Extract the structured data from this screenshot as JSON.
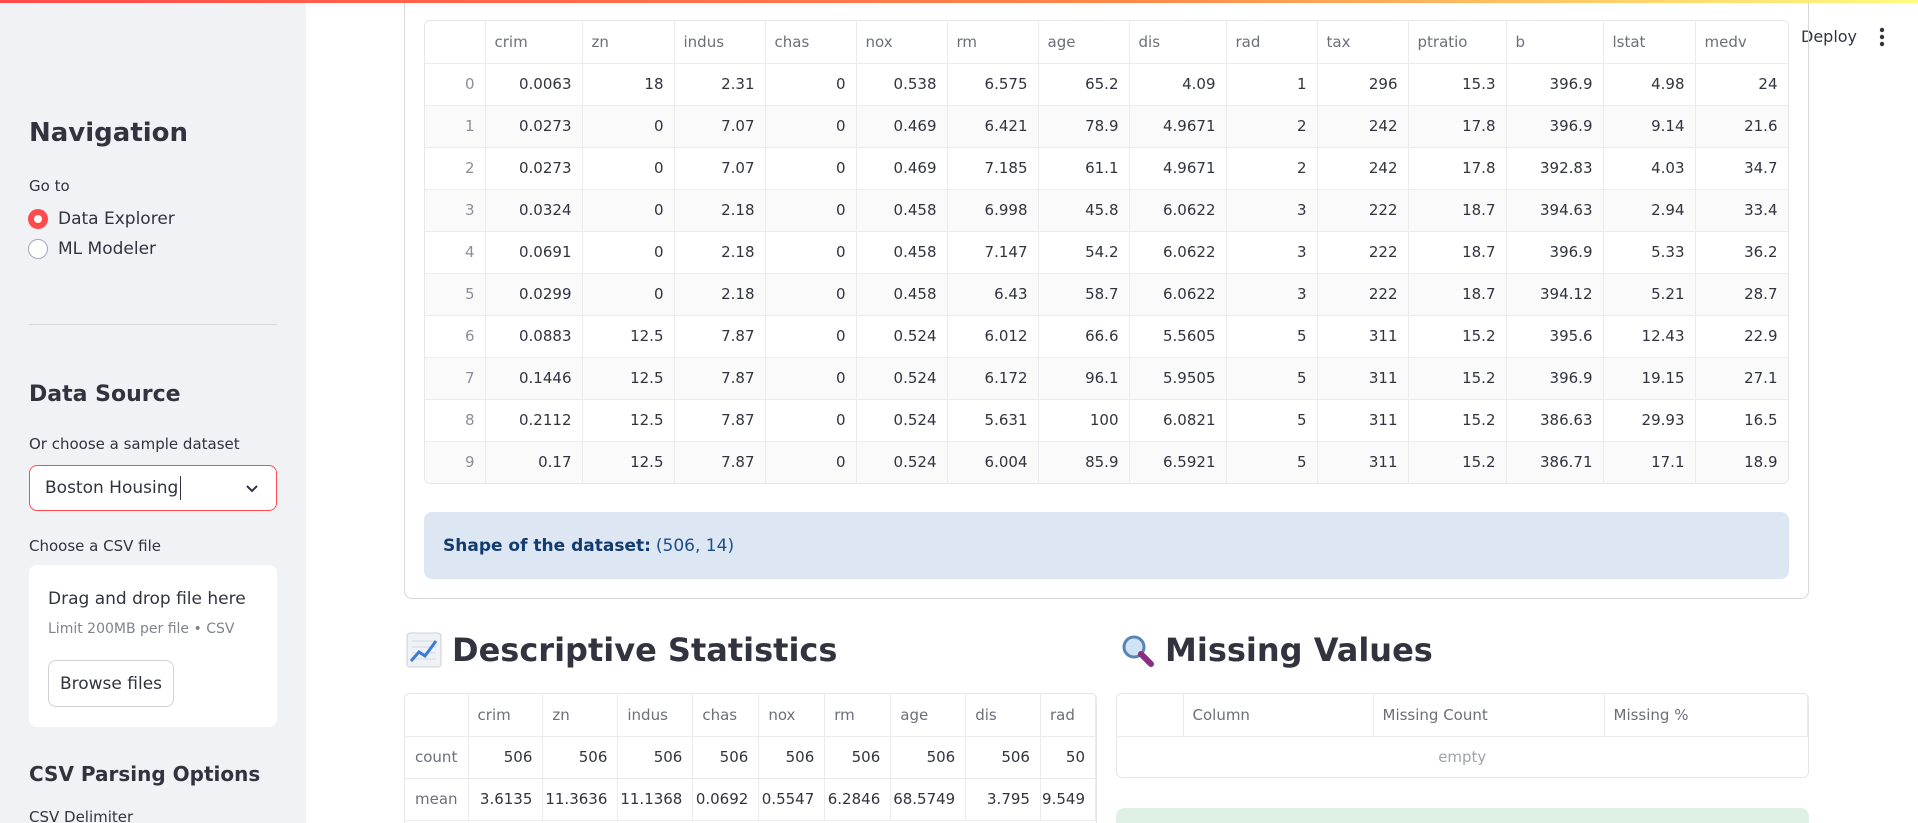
{
  "sidebar": {
    "nav_title": "Navigation",
    "goto_label": "Go to",
    "options": [
      {
        "label": "Data Explorer",
        "selected": true
      },
      {
        "label": "ML Modeler",
        "selected": false
      }
    ],
    "data_source_title": "Data Source",
    "sample_label": "Or choose a sample dataset",
    "sample_value": "Boston Housing",
    "csv_label": "Choose a CSV file",
    "dropzone_title": "Drag and drop file here",
    "dropzone_sub": "Limit 200MB per file • CSV",
    "browse_label": "Browse files",
    "csv_options_title": "CSV Parsing Options",
    "delimiter_label": "CSV Delimiter"
  },
  "header": {
    "deploy_label": "Deploy",
    "menu_icon": "kebab-menu-icon"
  },
  "dataframe": {
    "columns": [
      "",
      "crim",
      "zn",
      "indus",
      "chas",
      "nox",
      "rm",
      "age",
      "dis",
      "rad",
      "tax",
      "ptratio",
      "b",
      "lstat",
      "medv"
    ],
    "rows": [
      [
        "0",
        "0.0063",
        "18",
        "2.31",
        "0",
        "0.538",
        "6.575",
        "65.2",
        "4.09",
        "1",
        "296",
        "15.3",
        "396.9",
        "4.98",
        "24"
      ],
      [
        "1",
        "0.0273",
        "0",
        "7.07",
        "0",
        "0.469",
        "6.421",
        "78.9",
        "4.9671",
        "2",
        "242",
        "17.8",
        "396.9",
        "9.14",
        "21.6"
      ],
      [
        "2",
        "0.0273",
        "0",
        "7.07",
        "0",
        "0.469",
        "7.185",
        "61.1",
        "4.9671",
        "2",
        "242",
        "17.8",
        "392.83",
        "4.03",
        "34.7"
      ],
      [
        "3",
        "0.0324",
        "0",
        "2.18",
        "0",
        "0.458",
        "6.998",
        "45.8",
        "6.0622",
        "3",
        "222",
        "18.7",
        "394.63",
        "2.94",
        "33.4"
      ],
      [
        "4",
        "0.0691",
        "0",
        "2.18",
        "0",
        "0.458",
        "7.147",
        "54.2",
        "6.0622",
        "3",
        "222",
        "18.7",
        "396.9",
        "5.33",
        "36.2"
      ],
      [
        "5",
        "0.0299",
        "0",
        "2.18",
        "0",
        "0.458",
        "6.43",
        "58.7",
        "6.0622",
        "3",
        "222",
        "18.7",
        "394.12",
        "5.21",
        "28.7"
      ],
      [
        "6",
        "0.0883",
        "12.5",
        "7.87",
        "0",
        "0.524",
        "6.012",
        "66.6",
        "5.5605",
        "5",
        "311",
        "15.2",
        "395.6",
        "12.43",
        "22.9"
      ],
      [
        "7",
        "0.1446",
        "12.5",
        "7.87",
        "0",
        "0.524",
        "6.172",
        "96.1",
        "5.9505",
        "5",
        "311",
        "15.2",
        "396.9",
        "19.15",
        "27.1"
      ],
      [
        "8",
        "0.2112",
        "12.5",
        "7.87",
        "0",
        "0.524",
        "5.631",
        "100",
        "6.0821",
        "5",
        "311",
        "15.2",
        "386.63",
        "29.93",
        "16.5"
      ],
      [
        "9",
        "0.17",
        "12.5",
        "7.87",
        "0",
        "0.524",
        "6.004",
        "85.9",
        "6.5921",
        "5",
        "311",
        "15.2",
        "386.71",
        "17.1",
        "18.9"
      ]
    ]
  },
  "shape": {
    "label": "Shape of the dataset:",
    "value": "(506, 14)"
  },
  "descriptive": {
    "title": "Descriptive Statistics",
    "icon": "chart-increasing-icon",
    "columns": [
      "",
      "crim",
      "zn",
      "indus",
      "chas",
      "nox",
      "rm",
      "age",
      "dis",
      "rad"
    ],
    "rows": [
      [
        "count",
        "506",
        "506",
        "506",
        "506",
        "506",
        "506",
        "506",
        "506",
        "50"
      ],
      [
        "mean",
        "3.6135",
        "11.3636",
        "11.1368",
        "0.0692",
        "0.5547",
        "6.2846",
        "68.5749",
        "3.795",
        "9.549"
      ]
    ]
  },
  "missing": {
    "title": "Missing Values",
    "icon": "magnifier-icon",
    "columns": [
      "",
      "Column",
      "Missing Count",
      "Missing %"
    ],
    "empty_label": "empty"
  }
}
